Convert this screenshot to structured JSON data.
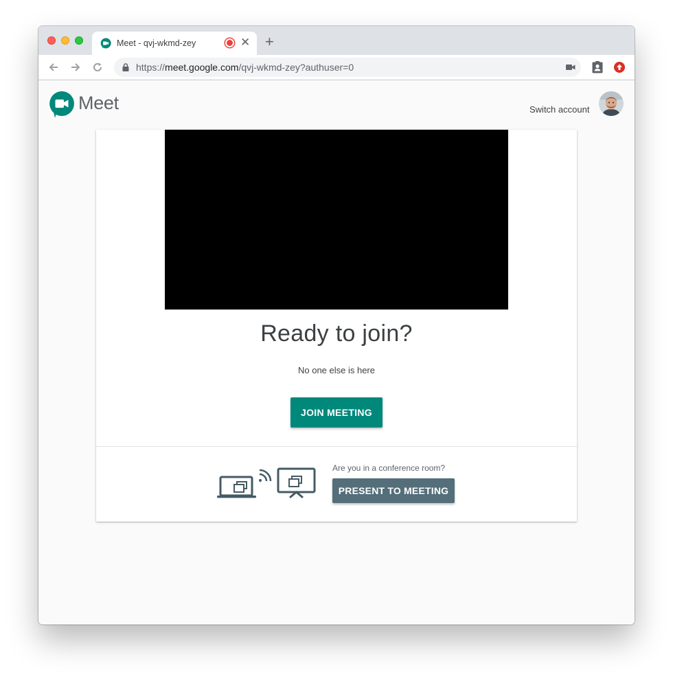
{
  "browser": {
    "tab_title": "Meet - qvj-wkmd-zey",
    "new_tab_label": "+",
    "url_scheme": "https://",
    "url_host": "meet.google.com",
    "url_path": "/qvj-wkmd-zey?authuser=0"
  },
  "header": {
    "brand": "Meet",
    "switch_account": "Switch account"
  },
  "lobby": {
    "headline": "Ready to join?",
    "status": "No one else is here",
    "join_label": "JOIN MEETING"
  },
  "conference": {
    "question": "Are you in a conference room?",
    "present_label": "PRESENT TO MEETING"
  },
  "colors": {
    "join_button": "#00897b",
    "present_button": "#546e7a",
    "meet_green": "#00897b"
  },
  "icons": [
    "meet-logo-icon",
    "recording-icon",
    "close-icon",
    "back-arrow-icon",
    "forward-arrow-icon",
    "reload-icon",
    "lock-icon",
    "camera-icon",
    "contact-extension-icon",
    "upload-extension-icon",
    "laptop-cast-icon",
    "tv-icon"
  ]
}
